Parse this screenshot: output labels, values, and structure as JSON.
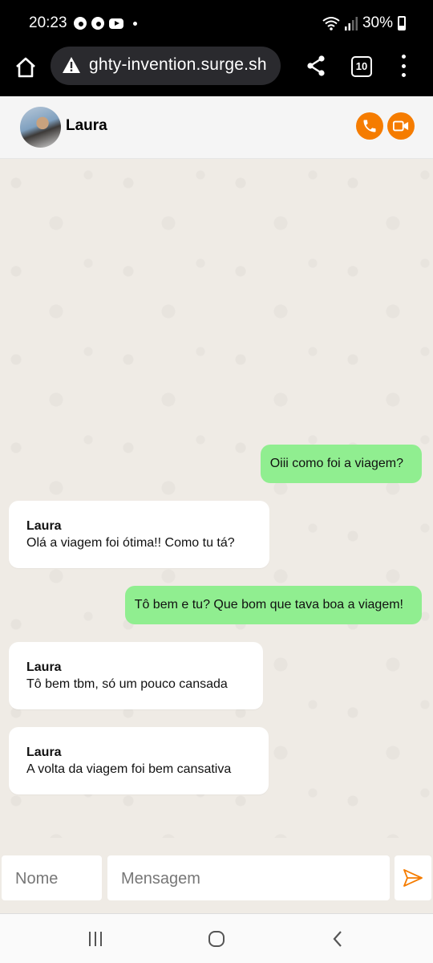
{
  "status_bar": {
    "time": "20:23",
    "battery": "30%",
    "notification_icons": [
      "chrome-icon",
      "chrome-icon",
      "youtube-icon"
    ]
  },
  "browser": {
    "url": "ghty-invention.surge.sh",
    "tab_count": "10"
  },
  "chat": {
    "contact_name": "Laura",
    "accent_color": "#f57c00",
    "outgoing_color": "#90ee90",
    "messages": [
      {
        "direction": "out",
        "text": "Oiii como foi a viagem?"
      },
      {
        "direction": "in",
        "sender": "Laura",
        "text": "Olá a viagem foi ótima!! Como tu tá?"
      },
      {
        "direction": "out",
        "text": "Tô bem e tu? Que bom que tava boa a viagem!"
      },
      {
        "direction": "in",
        "sender": "Laura",
        "text": "Tô bem tbm, só um pouco cansada"
      },
      {
        "direction": "in",
        "sender": "Laura",
        "text": "A volta da viagem foi bem cansativa"
      }
    ]
  },
  "composer": {
    "name_placeholder": "Nome",
    "message_placeholder": "Mensagem"
  }
}
